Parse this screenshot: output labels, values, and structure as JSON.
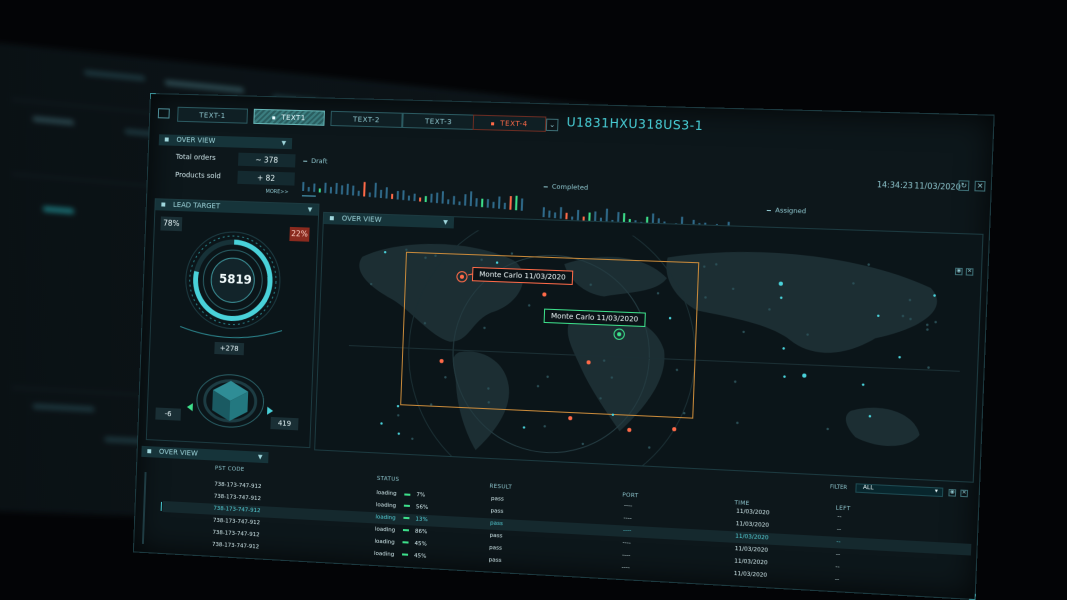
{
  "tabs": [
    {
      "label": "TEXT-1",
      "state": "normal"
    },
    {
      "label": "TEXT1",
      "state": "active"
    },
    {
      "label": "TEXT-2",
      "state": "normal"
    },
    {
      "label": "TEXT-3",
      "state": "normal"
    },
    {
      "label": "TEXT-4",
      "state": "warn"
    }
  ],
  "device_id": "U1831HXU318US3-1",
  "overview_top": {
    "title": "OVER VIEW",
    "total_orders_label": "Total orders",
    "total_orders_value": "~ 378",
    "products_sold_label": "Products sold",
    "products_sold_value": "+ 82",
    "more_label": "MORE>>"
  },
  "status_groups": [
    {
      "label": "Draft"
    },
    {
      "label": "Completed"
    },
    {
      "label": "Assigned"
    }
  ],
  "clock": {
    "time": "14:34:23",
    "date": "11/03/2020"
  },
  "lead_target": {
    "title": "LEAD TARGET",
    "left_pct": "78%",
    "right_pct": "22%",
    "gauge_value": "5819",
    "gauge_fraction": 0.78,
    "top_value": "+278",
    "left_value": "-6",
    "right_value": "419"
  },
  "map_panel": {
    "title": "OVER VIEW",
    "tags": [
      {
        "text": "Monte Carlo 11/03/2020",
        "style": "red"
      },
      {
        "text": "Monte Carlo 11/03/2020",
        "style": "green"
      }
    ]
  },
  "table_panel": {
    "title": "OVER VIEW",
    "filter_label": "FILTER",
    "filter_value": "ALL",
    "columns": [
      "PST CODE",
      "STATUS",
      "RESULT",
      "PORT",
      "TIME",
      "LEFT"
    ],
    "rows": [
      {
        "code": "738-173-747-912",
        "status": "loading",
        "pct": "7%",
        "result": "pass",
        "port": "----",
        "time": "11/03/2020",
        "left": "--",
        "selected": false
      },
      {
        "code": "738-173-747-912",
        "status": "loading",
        "pct": "56%",
        "result": "pass",
        "port": "----",
        "time": "11/03/2020",
        "left": "--",
        "selected": false
      },
      {
        "code": "738-173-747-912",
        "status": "loading",
        "pct": "13%",
        "result": "pass",
        "port": "----",
        "time": "11/03/2020",
        "left": "--",
        "selected": true
      },
      {
        "code": "738-173-747-912",
        "status": "loading",
        "pct": "86%",
        "result": "pass",
        "port": "----",
        "time": "11/03/2020",
        "left": "--",
        "selected": false
      },
      {
        "code": "738-173-747-912",
        "status": "loading",
        "pct": "45%",
        "result": "pass",
        "port": "----",
        "time": "11/03/2020",
        "left": "--",
        "selected": false
      },
      {
        "code": "738-173-747-912",
        "status": "loading",
        "pct": "45%",
        "result": "pass",
        "port": "----",
        "time": "11/03/2020",
        "left": "--",
        "selected": false
      }
    ]
  },
  "colors": {
    "accent": "#49d1d9",
    "warn": "#ff6a48",
    "bar": "#2f6a8a",
    "success": "#3de08b",
    "background": "#0d171b"
  }
}
